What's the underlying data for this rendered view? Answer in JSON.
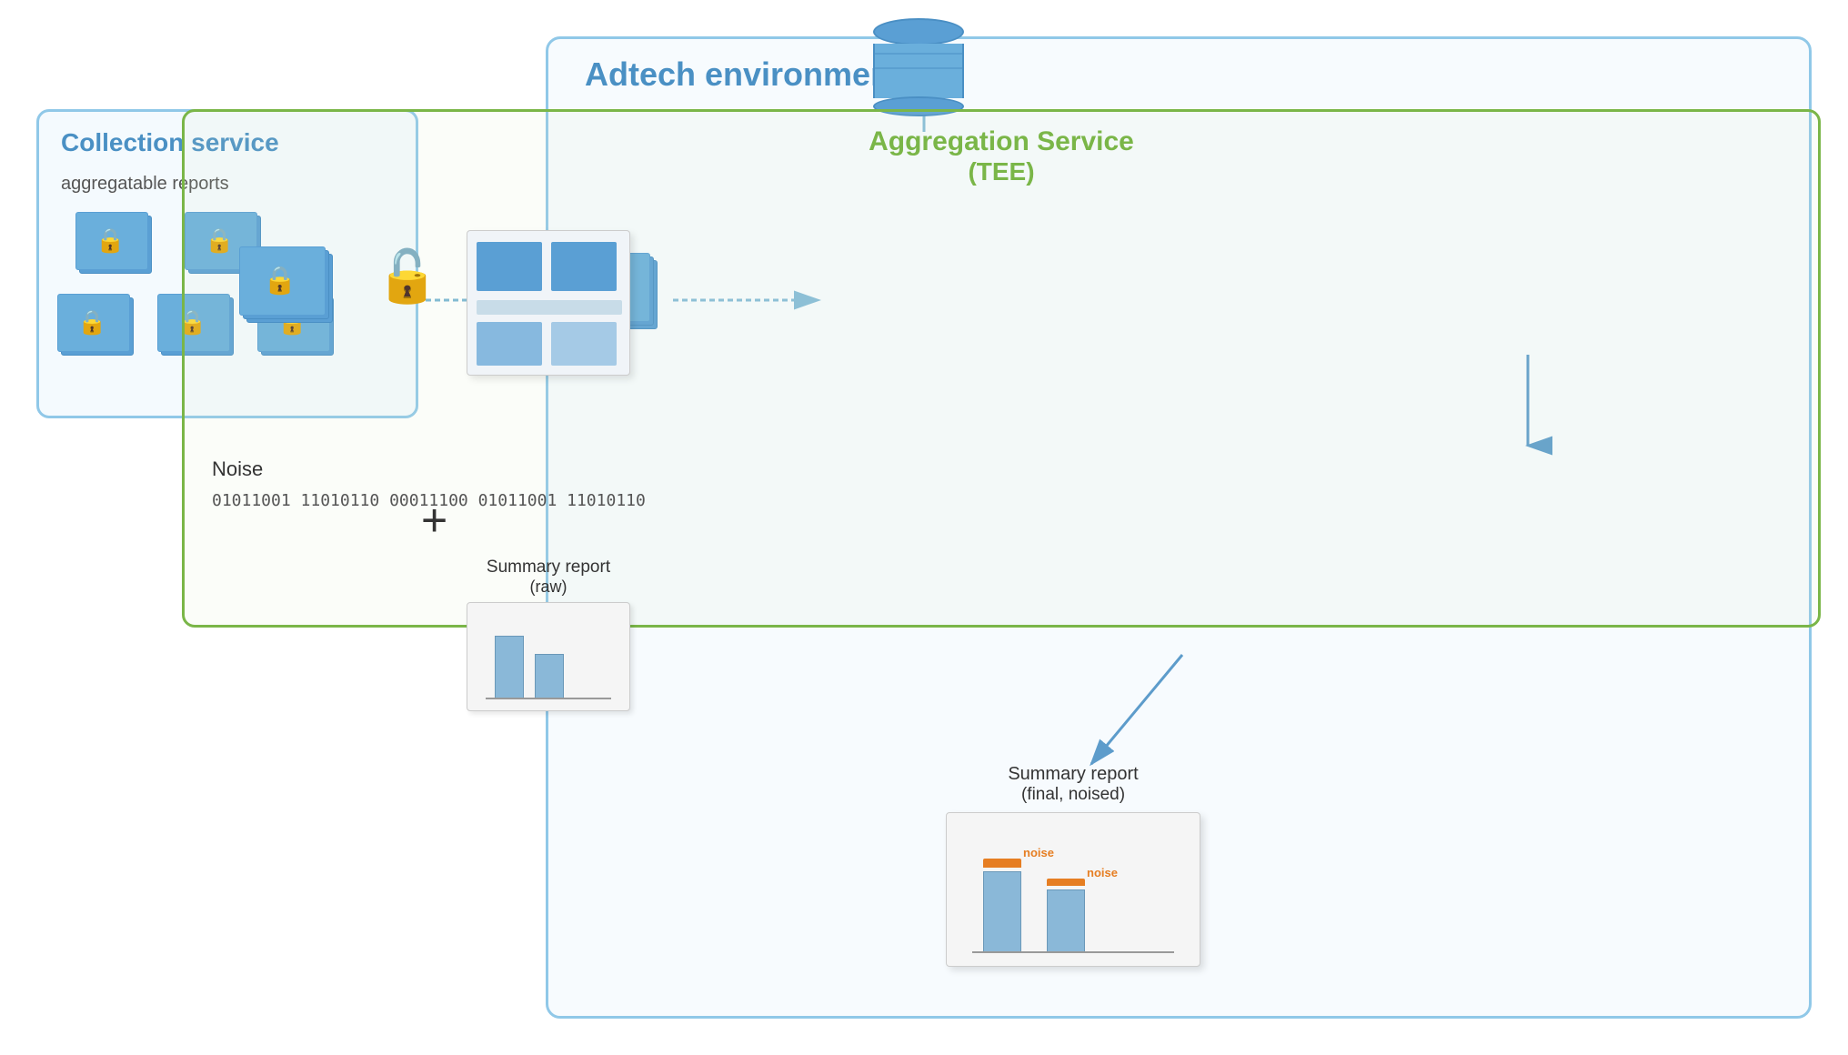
{
  "adtech": {
    "title": "Adtech environment"
  },
  "collection": {
    "title": "Collection service",
    "subtitle": "aggregatable reports"
  },
  "aggregation": {
    "title": "Aggregation Service",
    "subtitle": "(TEE)"
  },
  "noise": {
    "label": "Noise",
    "binary": "01011001\n11010110\n00011100\n01011001\n11010110"
  },
  "summary_raw": {
    "label": "Summary report",
    "sublabel": "(raw)"
  },
  "summary_final": {
    "label": "Summary report",
    "sublabel": "(final, noised)"
  },
  "noise_bar1": "noise",
  "noise_bar2": "noise",
  "icons": {
    "lock": "🔒",
    "lock_open": "🔓",
    "database": "🗄"
  }
}
